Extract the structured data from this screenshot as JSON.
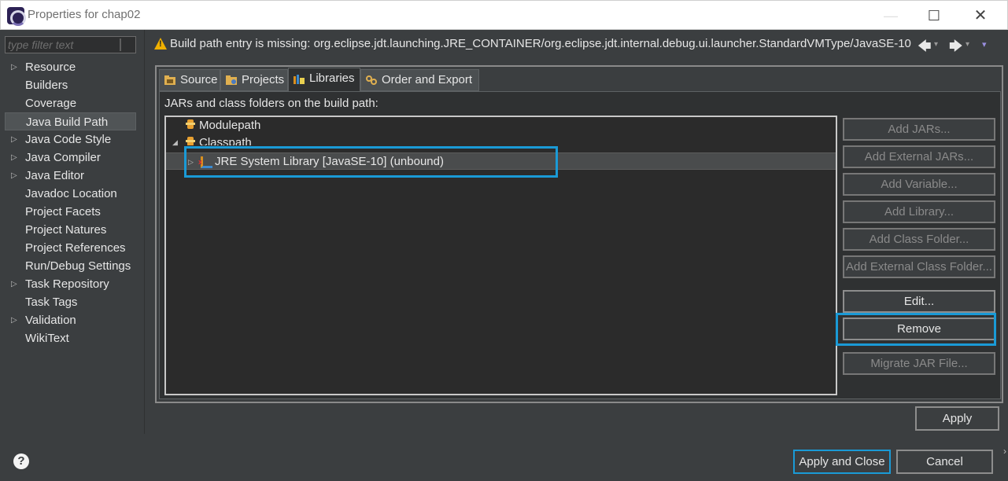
{
  "window": {
    "title": "Properties for chap02",
    "controls": {
      "minimize": "—",
      "maximize": "☐",
      "close": "✕"
    }
  },
  "filter": {
    "placeholder": "type filter text"
  },
  "sidebar": {
    "selected": "Java Build Path",
    "items": [
      {
        "label": "Resource",
        "expandable": true
      },
      {
        "label": "Builders",
        "expandable": false
      },
      {
        "label": "Coverage",
        "expandable": false
      },
      {
        "label": "Java Build Path",
        "expandable": false
      },
      {
        "label": "Java Code Style",
        "expandable": true
      },
      {
        "label": "Java Compiler",
        "expandable": true
      },
      {
        "label": "Java Editor",
        "expandable": true
      },
      {
        "label": "Javadoc Location",
        "expandable": false
      },
      {
        "label": "Project Facets",
        "expandable": false
      },
      {
        "label": "Project Natures",
        "expandable": false
      },
      {
        "label": "Project References",
        "expandable": false
      },
      {
        "label": "Run/Debug Settings",
        "expandable": false
      },
      {
        "label": "Task Repository",
        "expandable": true
      },
      {
        "label": "Task Tags",
        "expandable": false
      },
      {
        "label": "Validation",
        "expandable": true
      },
      {
        "label": "WikiText",
        "expandable": false
      }
    ]
  },
  "warning": {
    "text": "Build path entry is missing: org.eclipse.jdt.launching.JRE_CONTAINER/org.eclipse.jdt.internal.debug.ui.launcher.StandardVMType/JavaSE-10",
    "nav": {
      "back": "🡄",
      "forward": "🡆",
      "dropdown": "▾",
      "menu": "▾"
    }
  },
  "tabs": [
    {
      "label": "Source",
      "icon": "source-folder-icon",
      "active": false
    },
    {
      "label": "Projects",
      "icon": "projects-icon",
      "active": false
    },
    {
      "label": "Libraries",
      "icon": "libraries-icon",
      "active": true
    },
    {
      "label": "Order and Export",
      "icon": "order-export-icon",
      "active": false
    }
  ],
  "libraries": {
    "section_label": "JARs and class folders on the build path:",
    "tree": {
      "modulepath": "Modulepath",
      "classpath": "Classpath",
      "jre_entry": "JRE System Library [JavaSE-10] (unbound)"
    },
    "buttons": {
      "add_jars": "Add JARs...",
      "add_external_jars": "Add External JARs...",
      "add_variable": "Add Variable...",
      "add_library": "Add Library...",
      "add_class_folder": "Add Class Folder...",
      "add_external_class_folder": "Add External Class Folder...",
      "edit": "Edit...",
      "remove": "Remove",
      "migrate_jar": "Migrate JAR File..."
    }
  },
  "footer": {
    "apply": "Apply",
    "apply_and_close": "Apply and Close",
    "cancel": "Cancel",
    "help": "?"
  },
  "colors": {
    "highlight": "#1a9ad6",
    "background": "#3b3e40",
    "panel": "#2f3132",
    "warning": "#f0b000"
  }
}
